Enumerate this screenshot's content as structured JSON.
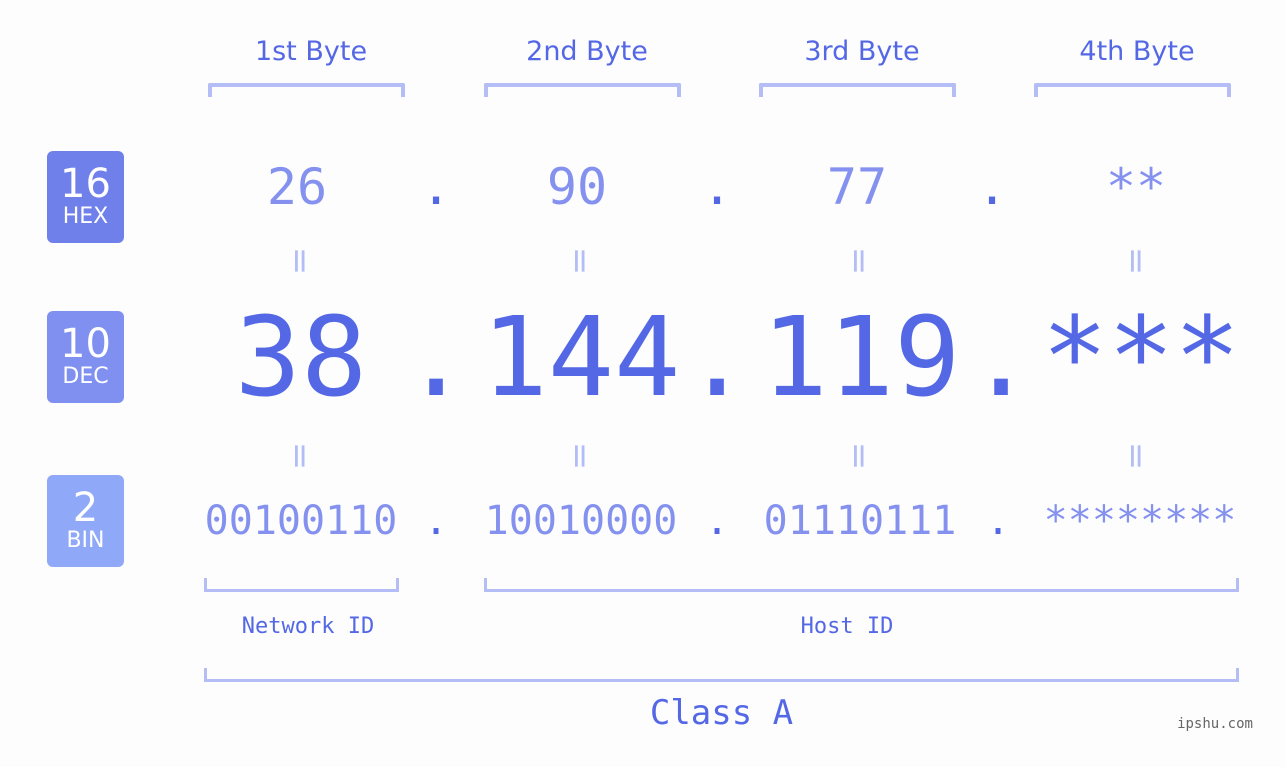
{
  "byte_headers": [
    "1st Byte",
    "2nd Byte",
    "3rd Byte",
    "4th Byte"
  ],
  "bases": [
    {
      "num": "16",
      "name": "HEX",
      "color": "#7080ea"
    },
    {
      "num": "10",
      "name": "DEC",
      "color": "#8090f0"
    },
    {
      "num": "2",
      "name": "BIN",
      "color": "#90a8f8"
    }
  ],
  "hex": [
    "26",
    "90",
    "77",
    "**"
  ],
  "dec": [
    "38",
    "144",
    "119",
    "***"
  ],
  "bin": [
    "00100110",
    "10010000",
    "01110111",
    "********"
  ],
  "separator": ".",
  "equals": "=",
  "network_label": "Network ID",
  "host_label": "Host ID",
  "class_label": "Class A",
  "watermark": "ipshu.com",
  "colors": {
    "accent": "#5468e6",
    "light": "#8491ef",
    "bracket": "#b4bdf6"
  }
}
